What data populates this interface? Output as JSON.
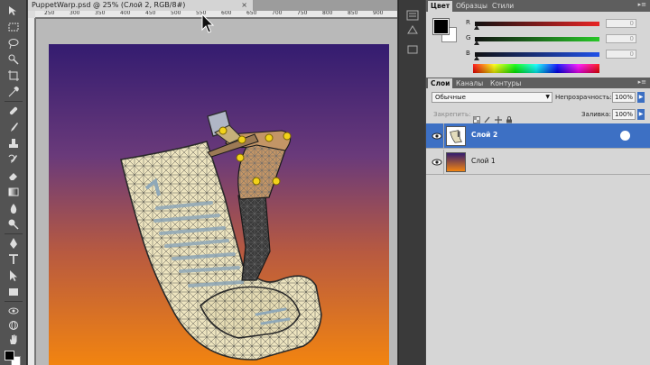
{
  "document": {
    "tab_title": "PuppetWarp.psd @ 25% (Слой 2, RGB/8#)",
    "close_glyph": "×",
    "ruler_marks": [
      "250",
      "300",
      "350",
      "400",
      "450",
      "500",
      "550",
      "600",
      "650",
      "700",
      "750",
      "800",
      "850",
      "900",
      "950"
    ]
  },
  "color_panel": {
    "tabs": [
      "Цвет",
      "Образцы",
      "Стили"
    ],
    "menu_glyph": "▸≡",
    "sliders": [
      {
        "label": "R",
        "value": "0",
        "color": "#e83030"
      },
      {
        "label": "G",
        "value": "0",
        "color": "#30c030"
      },
      {
        "label": "B",
        "value": "0",
        "color": "#2050e0"
      }
    ]
  },
  "layers_panel": {
    "tabs": [
      "Слои",
      "Каналы",
      "Контуры"
    ],
    "menu_glyph": "▸≡",
    "blend_mode": "Обычные",
    "opacity_label": "Непрозрачность:",
    "opacity_value": "100%",
    "lock_label": "Закрепить:",
    "fill_label": "Заливка:",
    "fill_value": "100%",
    "layers": [
      {
        "name": "Слой 2",
        "selected": true
      },
      {
        "name": "Слой 1",
        "selected": false
      }
    ]
  },
  "colors": {
    "selection_blue": "#3d70c4",
    "gradient_top": "#3a1a6e",
    "gradient_bottom": "#f08010"
  },
  "icons": [
    "move-icon",
    "marquee-icon",
    "lasso-icon",
    "quick-select-icon",
    "crop-icon",
    "eyedropper-icon",
    "healing-icon",
    "brush-icon",
    "clone-stamp-icon",
    "history-brush-icon",
    "eraser-icon",
    "gradient-icon",
    "blur-icon",
    "dodge-icon",
    "pen-icon",
    "type-icon",
    "path-select-icon",
    "shape-icon",
    "3d-rotate-icon",
    "3d-orbit-icon",
    "hand-icon",
    "zoom-icon"
  ]
}
